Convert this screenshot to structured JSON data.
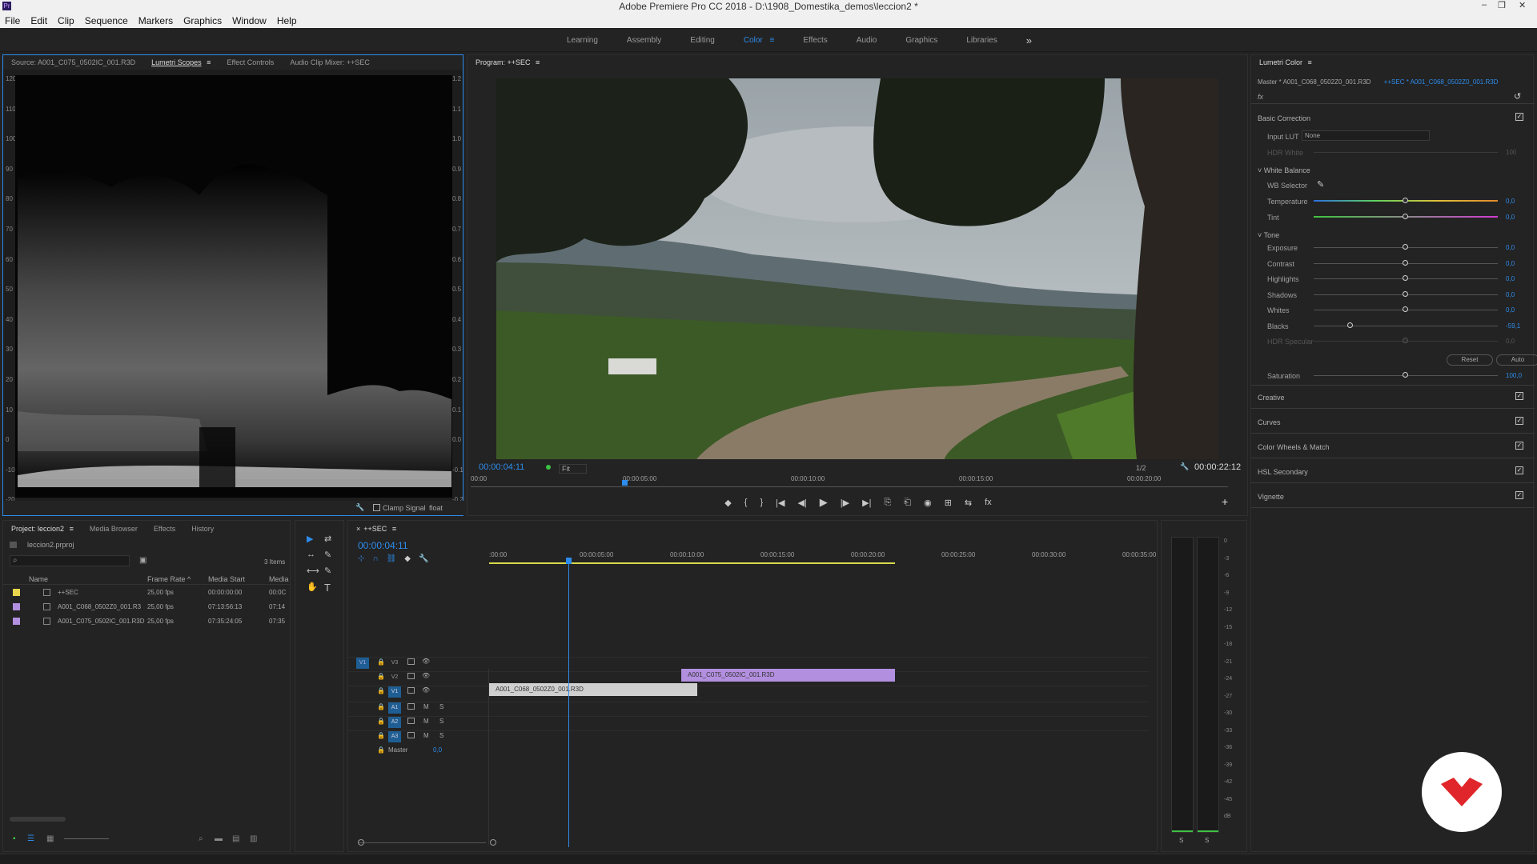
{
  "app": {
    "title": "Adobe Premiere Pro CC 2018 - D:\\1908_Domestika_demos\\leccion2 *",
    "min_icon": "minimize-icon",
    "max_icon": "maximize-icon",
    "close_icon": "close-icon",
    "win_min": "–",
    "win_max": "❐",
    "win_close": "✕"
  },
  "menu": [
    "File",
    "Edit",
    "Clip",
    "Sequence",
    "Markers",
    "Graphics",
    "Window",
    "Help"
  ],
  "workspaces": {
    "items": [
      "Learning",
      "Assembly",
      "Editing",
      "Color",
      "Effects",
      "Audio",
      "Graphics",
      "Libraries"
    ],
    "active": "Color",
    "more": "»",
    "menu_glyph": "≡"
  },
  "source_panel": {
    "tabs": [
      "Source: A001_C075_0502IC_001.R3D",
      "Lumetri Scopes",
      "Effect Controls",
      "Audio Clip Mixer: ++SEC"
    ],
    "menu_glyph": "≡",
    "left_scale": [
      "120",
      "110",
      "100",
      "90",
      "80",
      "70",
      "60",
      "50",
      "40",
      "30",
      "20",
      "10",
      "0",
      "-10",
      "-20"
    ],
    "right_scale": [
      "1.2",
      "1.1",
      "1.0",
      "0.9",
      "0.8",
      "0.7",
      "0.6",
      "0.5",
      "0.4",
      "0.3",
      "0.2",
      "0.1",
      "0.0",
      "-0.1",
      "-0.2"
    ],
    "clamp_label": "Clamp Signal",
    "float_label": "float",
    "wrench": "🔧"
  },
  "program": {
    "tab": "Program: ++SEC",
    "timecode": "00:00:04:11",
    "fit": "Fit",
    "resolution": "1/2",
    "duration": "00:00:22:12",
    "ruler": [
      "00:00",
      "00:00:05:00",
      "00:00:10:00",
      "00:00:15:00",
      "00:00:20:00"
    ],
    "playhead_pct": 0.2,
    "transport": [
      "◆",
      "{",
      "}",
      "|◀",
      "◀|",
      "▶",
      "|▶",
      "▶|",
      "⎘",
      "⎗",
      "◉",
      "⊞",
      "⇆",
      "fx"
    ],
    "add": "+"
  },
  "lumetri": {
    "title": "Lumetri Color",
    "menu_glyph": "≡",
    "master": "Master * A001_C068_0502Z0_001.R3D",
    "seq": "++SEC * A001_C068_0502Z0_001.R3D",
    "fx": "fx",
    "reset_icon": "↺",
    "basic": "Basic Correction",
    "input_lut_label": "Input LUT",
    "input_lut_value": "None",
    "hdr_white": "HDR White",
    "hdr_white_value": "100",
    "white_balance": "White Balance",
    "wb_selector": "WB Selector",
    "eyedropper": "✎",
    "temperature": "Temperature",
    "temperature_val": "0,0",
    "tint": "Tint",
    "tint_val": "0,0",
    "tone": "Tone",
    "tone_sliders": [
      {
        "label": "Exposure",
        "value": "0,0",
        "pos": 0.5
      },
      {
        "label": "Contrast",
        "value": "0,0",
        "pos": 0.5
      },
      {
        "label": "Highlights",
        "value": "0,0",
        "pos": 0.5
      },
      {
        "label": "Shadows",
        "value": "0,0",
        "pos": 0.5
      },
      {
        "label": "Whites",
        "value": "0,0",
        "pos": 0.5
      },
      {
        "label": "Blacks",
        "value": "-59,1",
        "pos": 0.2
      },
      {
        "label": "HDR Specular",
        "value": "0,0",
        "pos": 0.5
      }
    ],
    "reset": "Reset",
    "auto": "Auto",
    "saturation": "Saturation",
    "saturation_val": "100,0",
    "saturation_pos": 0.5,
    "temp_pos": 0.5,
    "tint_pos": 0.5,
    "sections": [
      "Creative",
      "Curves",
      "Color Wheels & Match",
      "HSL Secondary",
      "Vignette"
    ],
    "check": "✓",
    "caret": "˅"
  },
  "project": {
    "tabs": [
      "Project: leccion2",
      "Media Browser",
      "Effects",
      "History"
    ],
    "file": "leccion2.prproj",
    "items_count": "3 Items",
    "search_icon": "⌕",
    "bin_icon": "▣",
    "columns": [
      "Name",
      "Frame Rate",
      "Media Start",
      "Media"
    ],
    "sort": "^",
    "rows": [
      {
        "color": "#e8d44d",
        "name": "++SEC",
        "rate": "25,00 fps",
        "start": "00:00:00:00",
        "media": "00:0C"
      },
      {
        "color": "#b38fe0",
        "name": "A001_C068_0502Z0_001.R3",
        "rate": "25,00 fps",
        "start": "07:13:56:13",
        "media": "07:14"
      },
      {
        "color": "#b38fe0",
        "name": "A001_C075_0502IC_001.R3D",
        "rate": "25,00 fps",
        "start": "07:35:24:05",
        "media": "07:35"
      }
    ]
  },
  "tools": [
    "▶",
    "⇄",
    "↔",
    "✎",
    "✋",
    "T",
    "⬚",
    "⟷"
  ],
  "timeline": {
    "tab": "++SEC",
    "menu_glyph": "≡",
    "close": "×",
    "timecode": "00:00:04:11",
    "ruler": [
      ":00:00",
      "00:00:05:00",
      "00:00:10:00",
      "00:00:15:00",
      "00:00:20:00",
      "00:00:25:00",
      "00:00:30:00",
      "00:00:35:00"
    ],
    "tracks": [
      {
        "name": "V3",
        "target": "V1"
      },
      {
        "name": "V2",
        "target": ""
      },
      {
        "name": "V1",
        "target": ""
      },
      {
        "name": "A1",
        "target": ""
      },
      {
        "name": "A2",
        "target": ""
      },
      {
        "name": "A3",
        "target": ""
      }
    ],
    "master": "Master",
    "master_val": "0,0",
    "lock": "🔒",
    "eye": "👁",
    "m": "M",
    "s": "S",
    "clips": [
      {
        "name": "A001_C068_0502Z0_001.R3D",
        "track": "V1"
      },
      {
        "name": "A001_C075_0502IC_001.R3D",
        "track": "V2"
      }
    ],
    "meter_scale": [
      "0",
      "-3",
      "-6",
      "-9",
      "-12",
      "-15",
      "-18",
      "-21",
      "-24",
      "-27",
      "-30",
      "-33",
      "-36",
      "-39",
      "-42",
      "-45",
      "dB"
    ],
    "meter_s": "S"
  }
}
